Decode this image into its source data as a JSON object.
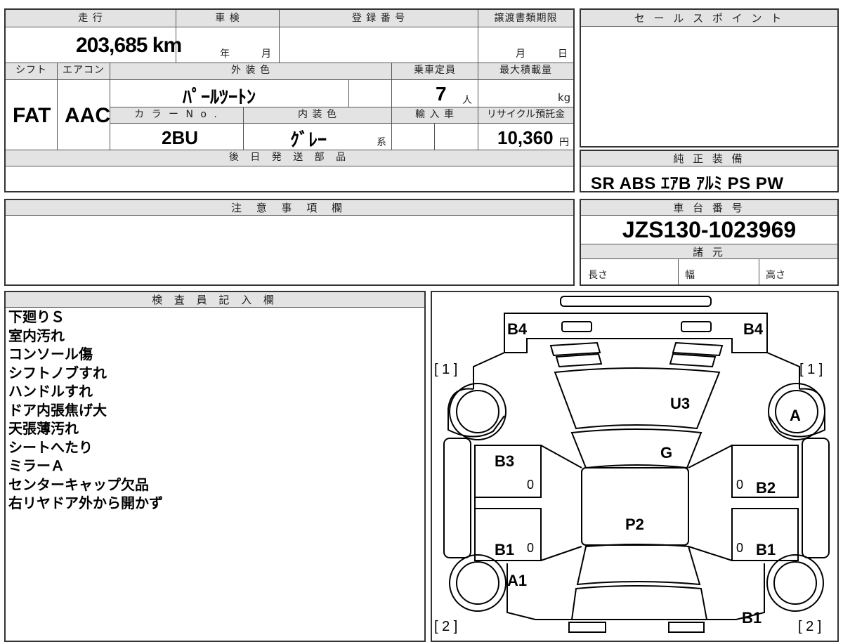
{
  "top_table": {
    "mileage_label": "走 行",
    "mileage_value": "203,685",
    "mileage_unit": "km",
    "inspection_label": "車 検",
    "inspection_year": "年",
    "inspection_month": "月",
    "registration_label": "登 録 番 号",
    "transfer_deadline_label": "譲渡書類期限",
    "transfer_month": "月",
    "transfer_day": "日",
    "shift_label": "シフト",
    "shift_value": "FAT",
    "aircon_label": "エアコン",
    "aircon_value": "AAC",
    "exterior_color_label": "外 装 色",
    "exterior_color_value": "ﾊﾟｰﾙﾂｰﾄﾝ",
    "capacity_label": "乗車定員",
    "capacity_value": "7",
    "capacity_unit": "人",
    "max_load_label": "最大積載量",
    "max_load_unit": "kg",
    "color_no_label": "カ ラ ー N o .",
    "color_no_value": "2BU",
    "interior_color_label": "内 装 色",
    "interior_color_value": "ｸﾞﾚｰ",
    "interior_color_suffix": "系",
    "import_label": "輸 入 車",
    "recycle_label": "リサイクル預託金",
    "recycle_value": "10,360",
    "recycle_unit": "円",
    "later_parts_label": "後 日 発 送 部 品"
  },
  "sales_point": {
    "label": "セ ー ル ス ポ イ ン ト"
  },
  "equipment": {
    "label": "純 正 装 備",
    "value": "SR ABS ｴｱB ｱﾙﾐ PS PW"
  },
  "caution": {
    "label": "注 意 事 項 欄"
  },
  "chassis": {
    "label": "車 台 番 号",
    "value": "JZS130-1023969"
  },
  "specs": {
    "label": "諸 元",
    "length": "長さ",
    "width": "幅",
    "height": "高さ"
  },
  "inspector": {
    "label": "検 査 員 記 入 欄",
    "notes": [
      "下廻りＳ",
      "室内汚れ",
      "コンソール傷",
      "シフトノブすれ",
      "ハンドルすれ",
      "ドア内張焦げ大",
      "天張薄汚れ",
      "シートへたり",
      "ミラーＡ",
      "センターキャップ欠品",
      "右リヤドア外から開かず"
    ]
  },
  "diagram": {
    "marks": {
      "b4_left": "B4",
      "b4_right": "B4",
      "u3": "U3",
      "a_right": "A",
      "g": "G",
      "b3": "B3",
      "b2": "B2",
      "p2": "P2",
      "b1_left": "B1",
      "b1_right": "B1",
      "a1": "A1",
      "b1_bottom": "B1",
      "zero": "0"
    },
    "brackets": {
      "front_left": "[ 1 ]",
      "front_right": "[ 1 ]",
      "rear_left": "[ 2 ]",
      "rear_right": "[ 2 ]"
    }
  }
}
